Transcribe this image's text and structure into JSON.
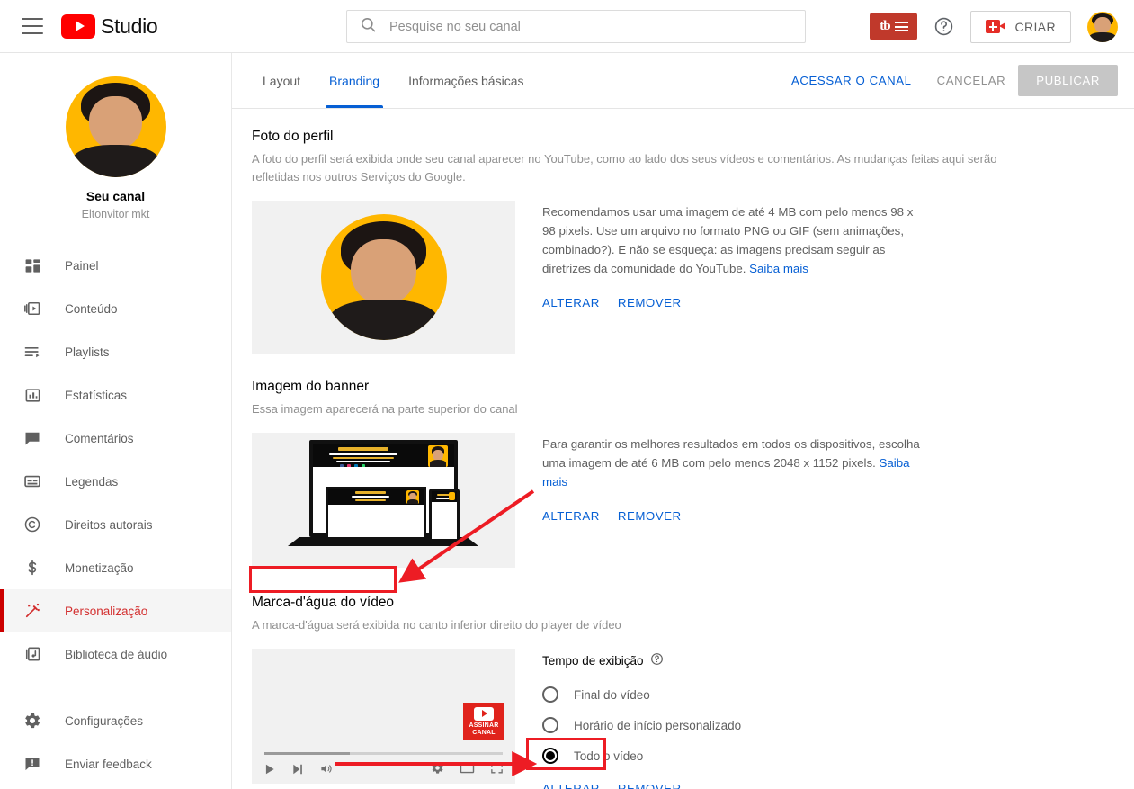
{
  "topbar": {
    "menu_icon": "hamburger-menu-icon",
    "brand": "Studio",
    "search_placeholder": "Pesquise no seu canal",
    "search_value": "",
    "search_icon": "search-icon",
    "tubebuddy_label": "tb",
    "help_icon": "help-circle-icon",
    "create_label": "CRIAR",
    "create_icon": "video-camera-plus-icon",
    "account_avatar": "user-avatar"
  },
  "sidebar": {
    "channel_title": "Seu canal",
    "channel_handle": "Eltonvitor mkt",
    "items": [
      {
        "label": "Painel",
        "icon": "dashboard-icon",
        "active": false
      },
      {
        "label": "Conteúdo",
        "icon": "content-video-icon",
        "active": false
      },
      {
        "label": "Playlists",
        "icon": "playlist-icon",
        "active": false
      },
      {
        "label": "Estatísticas",
        "icon": "analytics-bar-icon",
        "active": false
      },
      {
        "label": "Comentários",
        "icon": "comment-icon",
        "active": false
      },
      {
        "label": "Legendas",
        "icon": "subtitles-icon",
        "active": false
      },
      {
        "label": "Direitos autorais",
        "icon": "copyright-icon",
        "active": false
      },
      {
        "label": "Monetização",
        "icon": "dollar-icon",
        "active": false
      },
      {
        "label": "Personalização",
        "icon": "magic-wand-icon",
        "active": true
      },
      {
        "label": "Biblioteca de áudio",
        "icon": "audio-library-icon",
        "active": false
      }
    ],
    "footer_items": [
      {
        "label": "Configurações",
        "icon": "gear-icon"
      },
      {
        "label": "Enviar feedback",
        "icon": "feedback-icon"
      }
    ]
  },
  "tabs": [
    {
      "label": "Layout",
      "active": false
    },
    {
      "label": "Branding",
      "active": true
    },
    {
      "label": "Informações básicas",
      "active": false
    }
  ],
  "tab_actions": {
    "view_channel": "ACESSAR O CANAL",
    "cancel": "CANCELAR",
    "publish": "PUBLICAR"
  },
  "sections": {
    "profile": {
      "title": "Foto do perfil",
      "description": "A foto do perfil será exibida onde seu canal aparecer no YouTube, como ao lado dos seus vídeos e comentários. As mudanças feitas aqui serão refletidas nos outros Serviços do Google.",
      "help_text": "Recomendamos usar uma imagem de até 4 MB com pelo menos 98 x 98 pixels. Use um arquivo no formato PNG ou GIF (sem animações, combinado?). E não se esqueça: as imagens precisam seguir as diretrizes da comunidade do YouTube.",
      "learn_more": "Saiba mais",
      "change": "ALTERAR",
      "remove": "REMOVER"
    },
    "banner": {
      "title": "Imagem do banner",
      "description": "Essa imagem aparecerá na parte superior do canal",
      "help_text": "Para garantir os melhores resultados em todos os dispositivos, escolha uma imagem de até 6 MB com pelo menos 2048 x 1152 pixels.",
      "learn_more": "Saiba mais",
      "change": "ALTERAR",
      "remove": "REMOVER"
    },
    "watermark": {
      "title": "Marca-d'água do vídeo",
      "description": "A marca-d'água será exibida no canto inferior direito do player de vídeo",
      "display_time_label": "Tempo de exibição",
      "help_icon": "help-circle-icon",
      "options": [
        {
          "label": "Final do vídeo",
          "selected": false
        },
        {
          "label": "Horário de início personalizado",
          "selected": false
        },
        {
          "label": "Todo o vídeo",
          "selected": true
        }
      ],
      "watermark_badge_line1": "ASSINAR",
      "watermark_badge_line2": "CANAL",
      "change": "ALTERAR",
      "remove": "REMOVER"
    }
  },
  "player_controls": {
    "play_icon": "play-icon",
    "next_icon": "next-track-icon",
    "volume_icon": "volume-icon",
    "settings_icon": "gear-icon",
    "theater_icon": "theater-mode-icon",
    "fullscreen_icon": "fullscreen-icon"
  },
  "annotations": {
    "accent_color": "#ED1C24",
    "boxes": [
      "watermark-title-highlight",
      "watermark-change-highlight"
    ],
    "arrows": [
      "arrow-to-watermark-title",
      "arrow-to-change-button"
    ]
  },
  "colors": {
    "brand_red": "#FF0000",
    "link_blue": "#065fd4",
    "active_nav_red": "#CC0000",
    "avatar_yellow": "#FFB700",
    "annotation_red": "#ED1C24"
  }
}
